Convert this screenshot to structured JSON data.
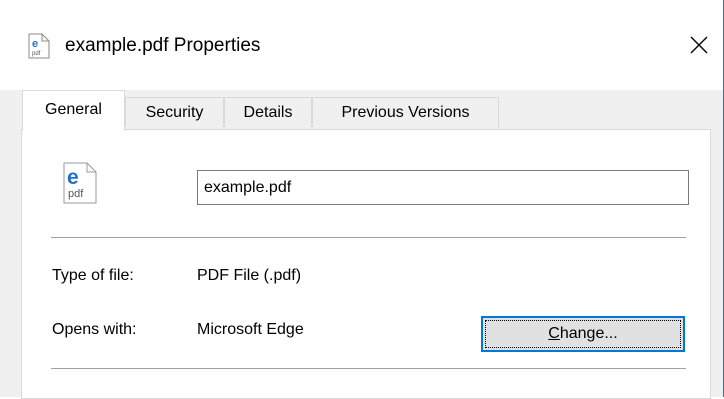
{
  "window": {
    "title": "example.pdf Properties",
    "close_glyph": "✕",
    "accent_color": "#1979ca"
  },
  "tabs": [
    {
      "label": "General",
      "active": true
    },
    {
      "label": "Security",
      "active": false
    },
    {
      "label": "Details",
      "active": false
    },
    {
      "label": "Previous Versions",
      "active": false
    }
  ],
  "general": {
    "file_icon": "edge-pdf-file-icon",
    "file_icon_letter": "e",
    "file_icon_caption": "pdf",
    "file_name": "example.pdf",
    "type_label": "Type of file:",
    "type_value": "PDF File (.pdf)",
    "opens_label": "Opens with:",
    "opens_value": "Microsoft Edge",
    "change_button": {
      "mnemonic": "C",
      "rest": "hange..."
    }
  }
}
